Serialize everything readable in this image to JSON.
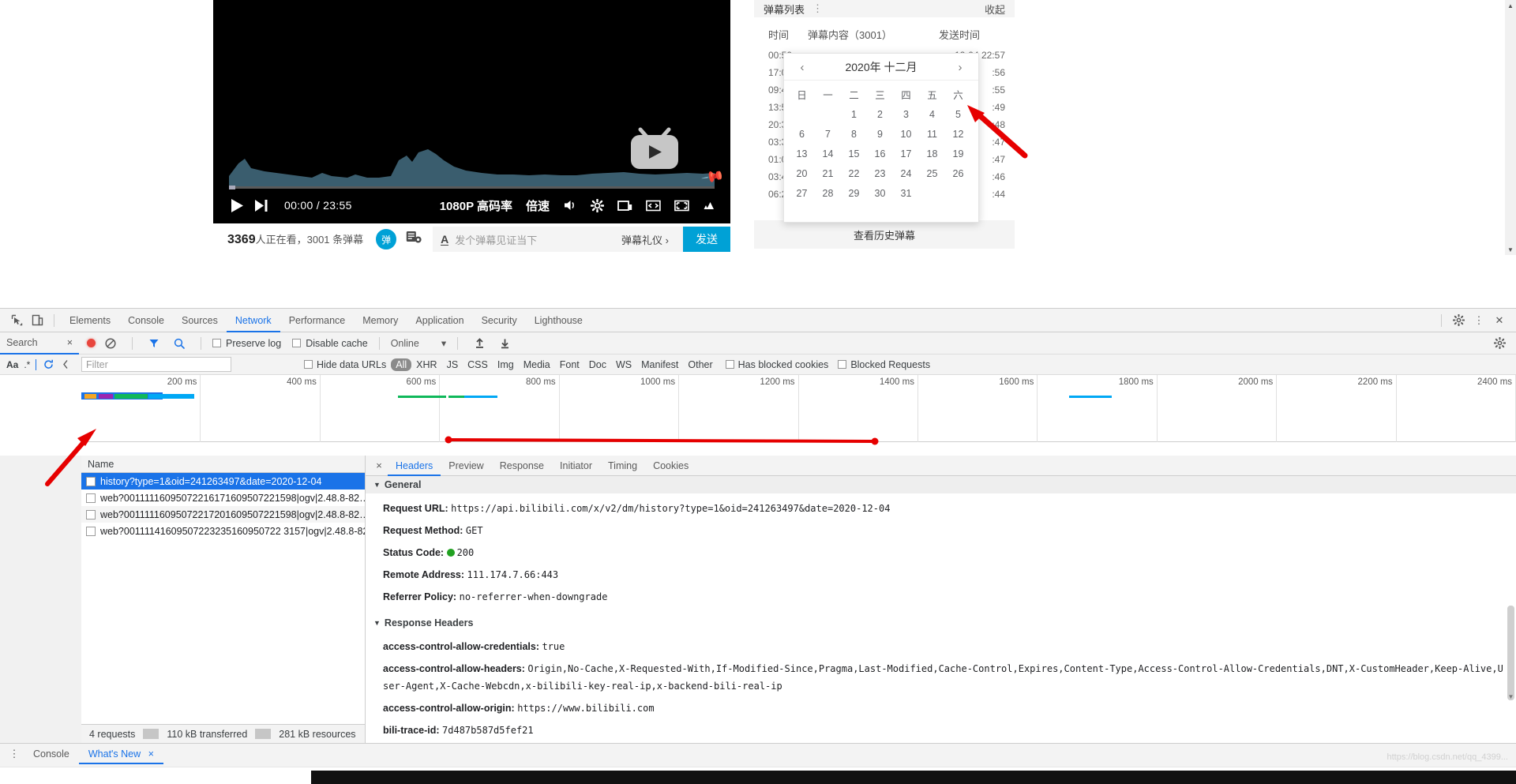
{
  "player": {
    "current_time": "00:00",
    "total_time": "23:55",
    "quality_label": "1080P 高码率",
    "speed_label": "倍速",
    "icons": [
      "play-icon",
      "next-episode-icon",
      "volume-icon",
      "settings-gear-icon",
      "widescreen-icon",
      "subtitle-icon",
      "fullscreen-icon",
      "danmaku-style-icon"
    ]
  },
  "video_meta": {
    "viewers_number": "3369",
    "viewers_suffix": "人正在看，",
    "danmaku_count_text": "3001 条弹幕",
    "danmaku_toggle_label": "弹",
    "input_placeholder": "发个弹幕见证当下",
    "gift_label": "弹幕礼仪 ›",
    "send_label": "发送"
  },
  "danmaku_panel": {
    "title": "弹幕列表",
    "collapse_label": "收起",
    "columns": [
      "时间",
      "弹幕内容（3001）",
      "发送时间"
    ],
    "rows": [
      {
        "time": "00:50",
        "content": "",
        "sent": "12-04 22:57"
      },
      {
        "time": "17:0",
        "content": "",
        "sent": ":56"
      },
      {
        "time": "09:4",
        "content": "",
        "sent": ":55"
      },
      {
        "time": "13:5",
        "content": "",
        "sent": ":49"
      },
      {
        "time": "20:3",
        "content": "",
        "sent": ":48"
      },
      {
        "time": "03:3",
        "content": "",
        "sent": ":47"
      },
      {
        "time": "01:0",
        "content": "",
        "sent": ":47"
      },
      {
        "time": "03:4",
        "content": "",
        "sent": ":46"
      },
      {
        "time": "06:2",
        "content": "",
        "sent": ":44"
      }
    ],
    "history_button": "查看历史弹幕"
  },
  "calendar": {
    "title": "2020年 十二月",
    "prev_icon": "‹",
    "next_icon": "›",
    "weekdays": [
      "日",
      "一",
      "二",
      "三",
      "四",
      "五",
      "六"
    ],
    "weeks": [
      [
        "",
        "",
        "1",
        "2",
        "3",
        "4",
        "5"
      ],
      [
        "6",
        "7",
        "8",
        "9",
        "10",
        "11",
        "12"
      ],
      [
        "13",
        "14",
        "15",
        "16",
        "17",
        "18",
        "19"
      ],
      [
        "20",
        "21",
        "22",
        "23",
        "24",
        "25",
        "26"
      ],
      [
        "27",
        "28",
        "29",
        "30",
        "31",
        "",
        ""
      ]
    ],
    "selected_day": "4",
    "accent": "#409eff"
  },
  "devtools": {
    "panel_tabs": [
      "Elements",
      "Console",
      "Sources",
      "Network",
      "Performance",
      "Memory",
      "Application",
      "Security",
      "Lighthouse"
    ],
    "active_panel_tab": "Network",
    "header_icons": [
      "inspect-element-icon",
      "device-toolbar-icon",
      "settings-gear-icon",
      "more-options-icon",
      "close-devtools-icon"
    ],
    "search": {
      "label": "Search",
      "close_icon": "×",
      "match_case_label": "Aa",
      "regex_label": ".*",
      "refresh_icon": "refresh-icon",
      "cancel_icon": "cancel-icon"
    },
    "network_toolbar": {
      "record_icon": "record-button",
      "clear_icon": "clear-icon",
      "filter_icon": "filter-funnel-icon",
      "search_icon": "search-magnifier-icon",
      "preserve_log": "Preserve log",
      "disable_cache": "Disable cache",
      "throttling": "Online",
      "throttle_caret": "▾",
      "import_icon": "import-har-icon",
      "export_icon": "export-har-icon",
      "settings_icon": "network-settings-gear-icon"
    },
    "filter_bar": {
      "filter_placeholder": "Filter",
      "hide_data_urls": "Hide data URLs",
      "types": [
        "All",
        "XHR",
        "JS",
        "CSS",
        "Img",
        "Media",
        "Font",
        "Doc",
        "WS",
        "Manifest",
        "Other"
      ],
      "active_type": "All",
      "has_blocked_cookies": "Has blocked cookies",
      "blocked_requests": "Blocked Requests"
    },
    "overview_ticks": [
      "200 ms",
      "400 ms",
      "600 ms",
      "800 ms",
      "1000 ms",
      "1200 ms",
      "1400 ms",
      "1600 ms",
      "1800 ms",
      "2000 ms",
      "2200 ms",
      "2400 ms"
    ],
    "request_table": {
      "name_header": "Name",
      "rows": [
        {
          "name": "history?type=1&oid=241263497&date=2020-12-04",
          "selected": true
        },
        {
          "name": "web?00111116095072216171609507221598|ogv|2.48.8-82…",
          "selected": false
        },
        {
          "name": "web?00111116095072217201609507221598|ogv|2.48.8-82…",
          "selected": false
        },
        {
          "name": "web?00111141609507223235160950722 3157|ogv|2.48.8-82…",
          "selected": false
        }
      ]
    },
    "status_bar": {
      "requests": "4 requests",
      "transferred": "110 kB transferred",
      "resources": "281 kB resources"
    },
    "detail_tabs": [
      "Headers",
      "Preview",
      "Response",
      "Initiator",
      "Timing",
      "Cookies"
    ],
    "active_detail_tab": "Headers",
    "detail_close_icon": "×",
    "general": {
      "section_title": "General",
      "items": [
        {
          "key": "Request URL:",
          "value": "https://api.bilibili.com/x/v2/dm/history?type=1&oid=241263497&date=2020-12-04"
        },
        {
          "key": "Request Method:",
          "value": "GET"
        },
        {
          "key": "Status Code:",
          "value": "200",
          "status_dot": "#21a121"
        },
        {
          "key": "Remote Address:",
          "value": "111.174.7.66:443"
        },
        {
          "key": "Referrer Policy:",
          "value": "no-referrer-when-downgrade"
        }
      ]
    },
    "response_headers": {
      "section_title": "Response Headers",
      "items": [
        {
          "key": "access-control-allow-credentials:",
          "value": "true"
        },
        {
          "key": "access-control-allow-headers:",
          "value": "Origin,No-Cache,X-Requested-With,If-Modified-Since,Pragma,Last-Modified,Cache-Control,Expires,Content-Type,Access-Control-Allow-Credentials,DNT,X-CustomHeader,Keep-Alive,User-Agent,X-Cache-Webcdn,x-bilibili-key-real-ip,x-backend-bili-real-ip"
        },
        {
          "key": "access-control-allow-origin:",
          "value": "https://www.bilibili.com"
        },
        {
          "key": "bili-trace-id:",
          "value": "7d487b587d5fef21"
        }
      ]
    },
    "drawer": {
      "more_icon": "drawer-more-icon",
      "tabs": [
        "Console",
        "What's New"
      ],
      "active_tab": "What's New",
      "close_icon": "×"
    }
  },
  "watermark": "https://blog.csdn.net/qq_4399...",
  "colors": {
    "devtools_accent": "#1a73e8",
    "bili_blue": "#00a1d6",
    "status_green": "#21a121",
    "record_red": "#e8453c",
    "annotation_red": "#e60000"
  }
}
